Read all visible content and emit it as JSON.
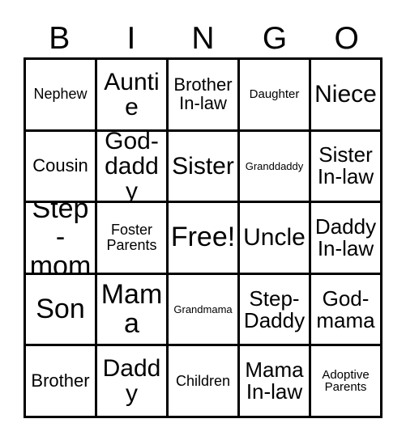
{
  "card": {
    "title": "BINGO",
    "free_space_label": "Free!",
    "colors": {
      "border": "#000000",
      "text": "#000000",
      "background": "#ffffff"
    },
    "header": {
      "letters": [
        {
          "label": "B"
        },
        {
          "label": "I"
        },
        {
          "label": "N"
        },
        {
          "label": "G"
        },
        {
          "label": "O"
        }
      ]
    },
    "grid": {
      "rows": 5,
      "columns": 5,
      "cells": [
        [
          {
            "label": "Nephew",
            "size": "sm",
            "free": false
          },
          {
            "label": "Auntie",
            "size": "xl",
            "free": false
          },
          {
            "label": "Brother In-law",
            "size": "md",
            "free": false
          },
          {
            "label": "Daughter",
            "size": "xs",
            "free": false
          },
          {
            "label": "Niece",
            "size": "xl",
            "free": false
          }
        ],
        [
          {
            "label": "Cousin",
            "size": "md",
            "free": false
          },
          {
            "label": "God-daddy",
            "size": "xl",
            "free": false
          },
          {
            "label": "Sister",
            "size": "xl",
            "free": false
          },
          {
            "label": "Granddaddy",
            "size": "xxs",
            "free": false
          },
          {
            "label": "Sister In-law",
            "size": "lg",
            "free": false
          }
        ],
        [
          {
            "label": "Step-mom",
            "size": "xxl",
            "free": false
          },
          {
            "label": "Foster Parents",
            "size": "sm",
            "free": false
          },
          {
            "label": "Free!",
            "size": "xxl",
            "free": true
          },
          {
            "label": "Uncle",
            "size": "xl",
            "free": false
          },
          {
            "label": "Daddy In-law",
            "size": "lg",
            "free": false
          }
        ],
        [
          {
            "label": "Son",
            "size": "xxl",
            "free": false
          },
          {
            "label": "Mama",
            "size": "xxl",
            "free": false
          },
          {
            "label": "Grandmama",
            "size": "xxs",
            "free": false
          },
          {
            "label": "Step-Daddy",
            "size": "lg",
            "free": false
          },
          {
            "label": "God-mama",
            "size": "lg",
            "free": false
          }
        ],
        [
          {
            "label": "Brother",
            "size": "md",
            "free": false
          },
          {
            "label": "Daddy",
            "size": "xl",
            "free": false
          },
          {
            "label": "Children",
            "size": "sm",
            "free": false
          },
          {
            "label": "Mama In-law",
            "size": "lg",
            "free": false
          },
          {
            "label": "Adoptive Parents",
            "size": "xs",
            "free": false
          }
        ]
      ]
    }
  }
}
